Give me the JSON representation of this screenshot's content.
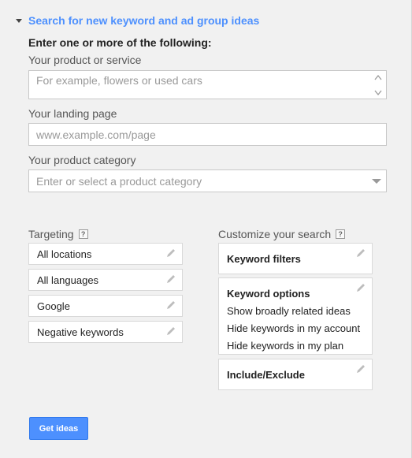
{
  "header": {
    "title": "Search for new keyword and ad group ideas"
  },
  "form": {
    "instruction": "Enter one or more of the following:",
    "product": {
      "label": "Your product or service",
      "placeholder": "For example, flowers or used cars"
    },
    "landing": {
      "label": "Your landing page",
      "placeholder": "www.example.com/page"
    },
    "category": {
      "label": "Your product category",
      "placeholder": "Enter or select a product category"
    }
  },
  "targeting": {
    "label": "Targeting",
    "help": "?",
    "items": [
      "All locations",
      "All languages",
      "Google",
      "Negative keywords"
    ]
  },
  "customize": {
    "label": "Customize your search",
    "help": "?",
    "keyword_filters": "Keyword filters",
    "keyword_options": {
      "title": "Keyword options",
      "lines": [
        "Show broadly related ideas",
        "Hide keywords in my account",
        "Hide keywords in my plan"
      ]
    },
    "include_exclude": "Include/Exclude"
  },
  "actions": {
    "get_ideas": "Get ideas"
  },
  "colors": {
    "accent": "#4d90fe",
    "background": "#f1f1f1"
  },
  "icons": [
    "caret-down-icon",
    "spinner-up-icon",
    "spinner-down-icon",
    "dropdown-arrow-icon",
    "help-icon",
    "pencil-icon"
  ]
}
